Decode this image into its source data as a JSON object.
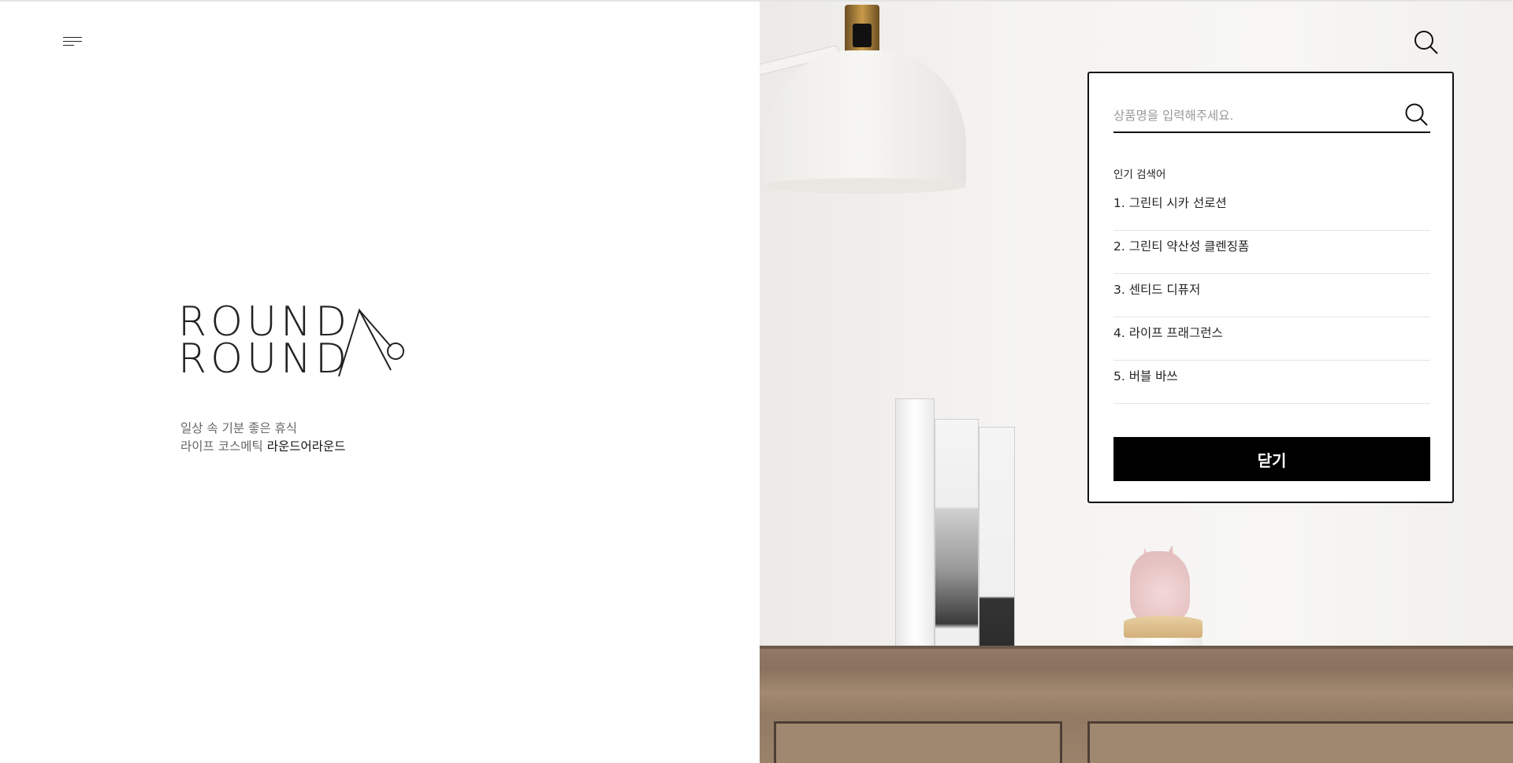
{
  "header": {
    "menu_icon": "hamburger-menu-icon",
    "search_icon": "search-icon"
  },
  "brand": {
    "logo_line1": "ROUND",
    "logo_line2": "ROUND",
    "tagline_line1": "일상 속 기분 좋은 휴식",
    "tagline_line2_prefix": "라이프 코스메틱 ",
    "tagline_line2_brand": "라운드어라운드"
  },
  "search": {
    "placeholder": "상품명을 입력해주세요.",
    "value": "",
    "popular_title": "인기 검색어",
    "popular": [
      "1. 그린티 시카 선로션",
      "2. 그린티 약산성 클렌징폼",
      "3. 센티드 디퓨저",
      "4. 라이프 프래그런스",
      "5. 버블 바쓰"
    ],
    "close_label": "닫기"
  },
  "colors": {
    "text": "#222222",
    "accent": "#000000",
    "border": "#111111"
  }
}
